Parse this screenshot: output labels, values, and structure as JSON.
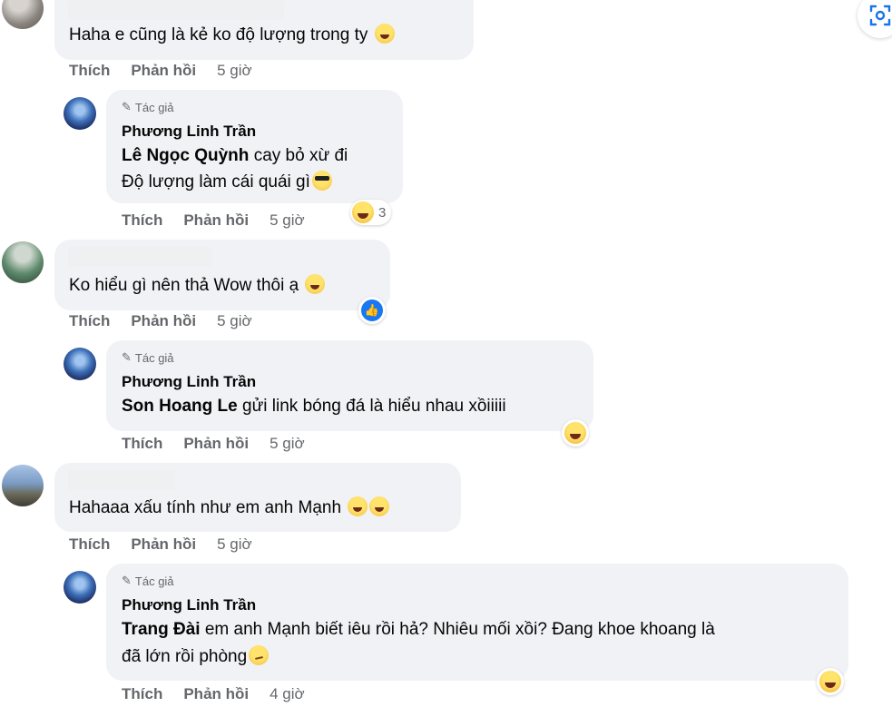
{
  "labels": {
    "like": "Thích",
    "reply": "Phản hồi",
    "author_badge": "Tác giả"
  },
  "comments": [
    {
      "text": "Haha e cũng là kẻ ko độ lượng trong ty",
      "time": "5 giờ",
      "reply": {
        "name": "Phương Linh Trần",
        "mention": "Lê Ngọc Quỳnh",
        "line1": "cay bỏ xừ đi",
        "line2": "Độ lượng làm cái quái gì",
        "time": "5 giờ",
        "reaction_count": "3"
      }
    },
    {
      "text": "Ko hiểu gì nên thả Wow thôi ạ",
      "time": "5 giờ",
      "reply": {
        "name": "Phương Linh Trần",
        "mention": "Son Hoang Le",
        "line1": "gửi link bóng đá là hiểu nhau xồiiiii",
        "time": "5 giờ"
      }
    },
    {
      "text": "Hahaaa xấu tính như em anh Mạnh",
      "time": "5 giờ",
      "reply": {
        "name": "Phương Linh Trần",
        "mention": "Trang Đài",
        "line1": "em anh Mạnh biết iêu rồi hả? Nhiêu mối xồi? Đang khoe khoang là",
        "line2": "đã lớn rồi phòng",
        "time": "4 giờ"
      }
    }
  ],
  "colors": {
    "bubble": "#f0f2f5",
    "meta": "#65676b",
    "text": "#050505",
    "like_blue": "#1877f2"
  },
  "icons": [
    "pencil-icon",
    "laughing-emoji",
    "sunglasses-emoji",
    "smirk-emoji",
    "like-reaction-icon",
    "visual-search-icon"
  ]
}
